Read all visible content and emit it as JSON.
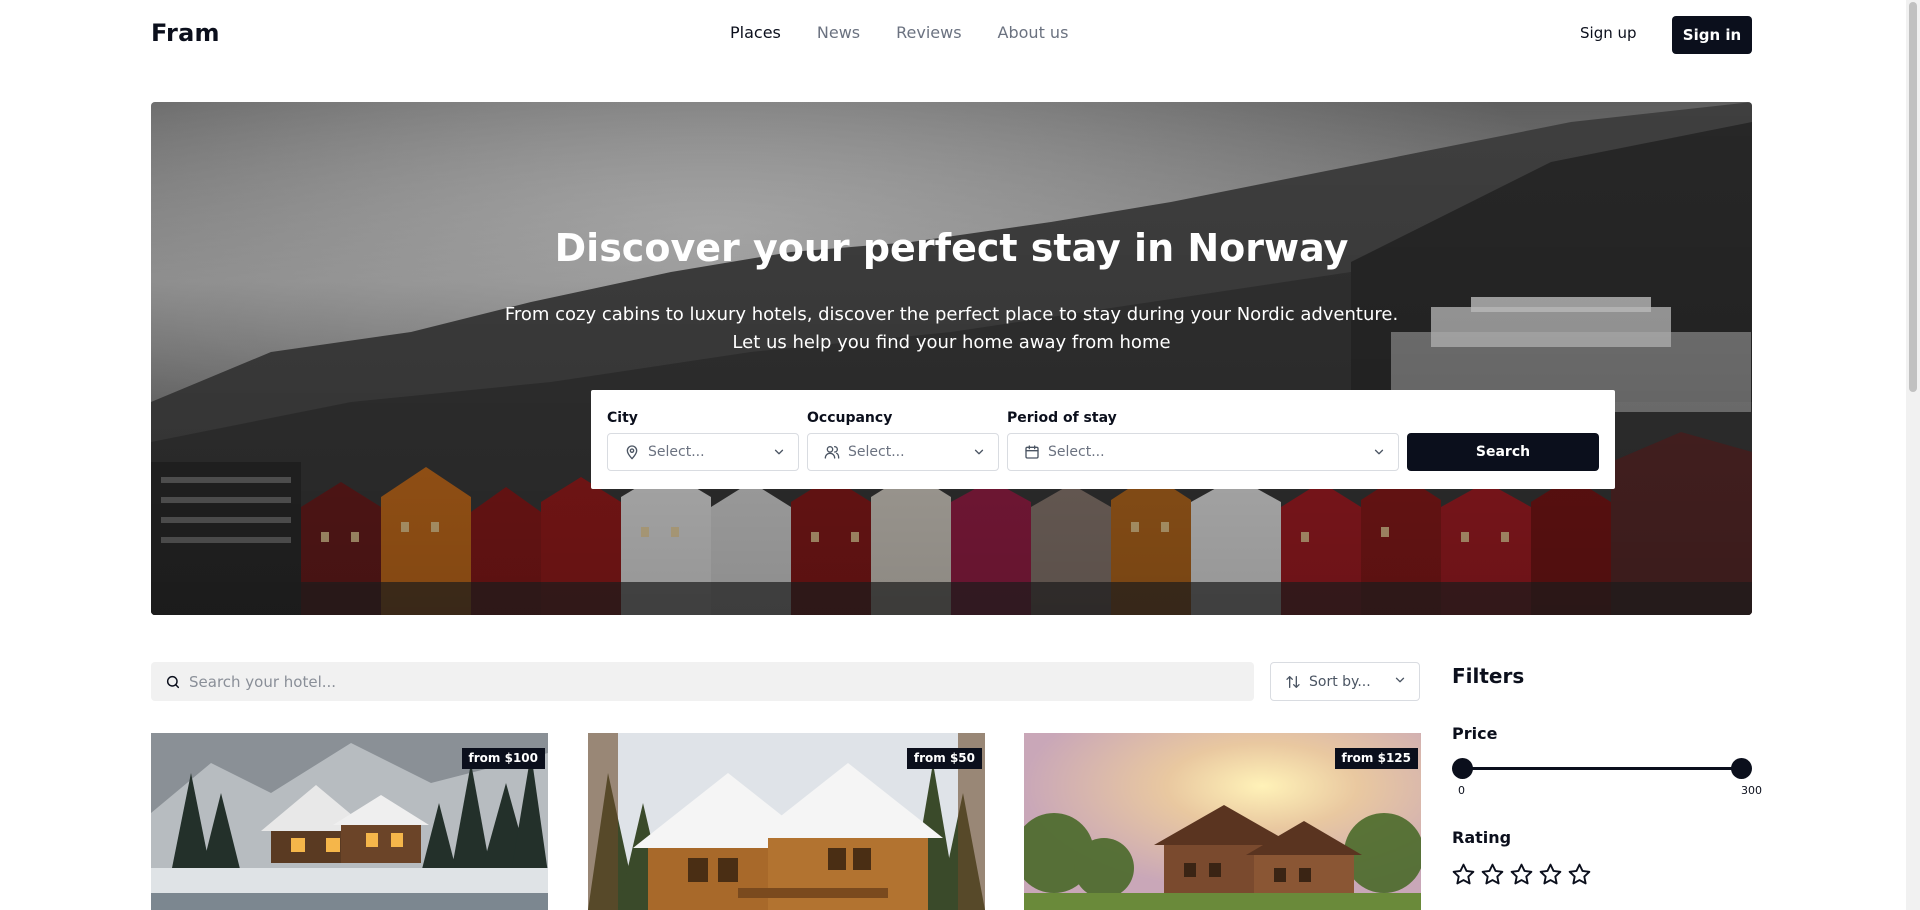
{
  "header": {
    "brand": "Fram",
    "nav": [
      {
        "label": "Places",
        "active": true
      },
      {
        "label": "News",
        "active": false
      },
      {
        "label": "Reviews",
        "active": false
      },
      {
        "label": "About us",
        "active": false
      }
    ],
    "signup_label": "Sign up",
    "signin_label": "Sign in"
  },
  "hero": {
    "title": "Discover your perfect stay in Norway",
    "subtitle_line1": "From cozy cabins to luxury hotels, discover the perfect place to stay during your Nordic adventure.",
    "subtitle_line2": "Let us help you find your home away from home"
  },
  "search": {
    "city": {
      "label": "City",
      "placeholder": "Select...",
      "icon": "map-pin-icon"
    },
    "occupancy": {
      "label": "Occupancy",
      "placeholder": "Select...",
      "icon": "user-icon"
    },
    "period": {
      "label": "Period of stay",
      "placeholder": "Select...",
      "icon": "calendar-icon"
    },
    "button_label": "Search"
  },
  "listing": {
    "search_placeholder": "Search your hotel...",
    "sort_label": "Sort by...",
    "cards": [
      {
        "price": "from $100"
      },
      {
        "price": "from $50"
      },
      {
        "price": "from $125"
      }
    ]
  },
  "filters": {
    "title": "Filters",
    "price": {
      "label": "Price",
      "min": "0",
      "max": "300",
      "selected_min": 0,
      "selected_max": 300
    },
    "rating": {
      "label": "Rating",
      "stars": 5,
      "selected": 0
    }
  },
  "colors": {
    "primary": "#0b0f1c",
    "muted_text": "#6b7280",
    "input_bg": "#f1f1f1"
  }
}
